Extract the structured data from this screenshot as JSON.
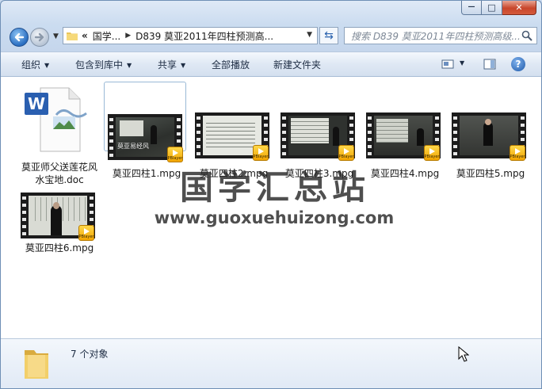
{
  "window": {
    "caption": {
      "minimize_glyph": "—",
      "maximize_glyph": "□",
      "close_glyph": "✕"
    }
  },
  "nav": {
    "address_prefix": "«",
    "breadcrumbs": [
      "国学...",
      "D839 莫亚2011年四柱预测高..."
    ],
    "search_placeholder": "搜索 D839 莫亚2011年四柱预测高级..."
  },
  "toolbar": {
    "organize": "组织",
    "include_in_library": "包含到库中",
    "share": "共享",
    "play_all": "全部播放",
    "new_folder": "新建文件夹",
    "help": "?"
  },
  "files": [
    {
      "name": "莫亚师父送莲花风水宝地.doc",
      "type": "doc",
      "selected": false
    },
    {
      "name": "莫亚四柱1.mpg",
      "type": "video",
      "selected": true,
      "frame_text": "莫亚易经风"
    },
    {
      "name": "莫亚四柱2.mpg",
      "type": "video",
      "selected": false
    },
    {
      "name": "莫亚四柱3.mpg",
      "type": "video",
      "selected": false
    },
    {
      "name": "莫亚四柱4.mpg",
      "type": "video",
      "selected": false
    },
    {
      "name": "莫亚四柱5.mpg",
      "type": "video",
      "selected": false
    },
    {
      "name": "莫亚四柱6.mpg",
      "type": "video",
      "selected": false
    }
  ],
  "badge_text": "PBlayer",
  "watermark": {
    "title": "国学汇总站",
    "url": "www.guoxuehuizong.com"
  },
  "details": {
    "item_count": "7 个对象"
  },
  "colors": {
    "accent": "#2a6ec1",
    "chrome": "#c5d6ec",
    "badge": "#f1a400",
    "close": "#c8462b"
  }
}
